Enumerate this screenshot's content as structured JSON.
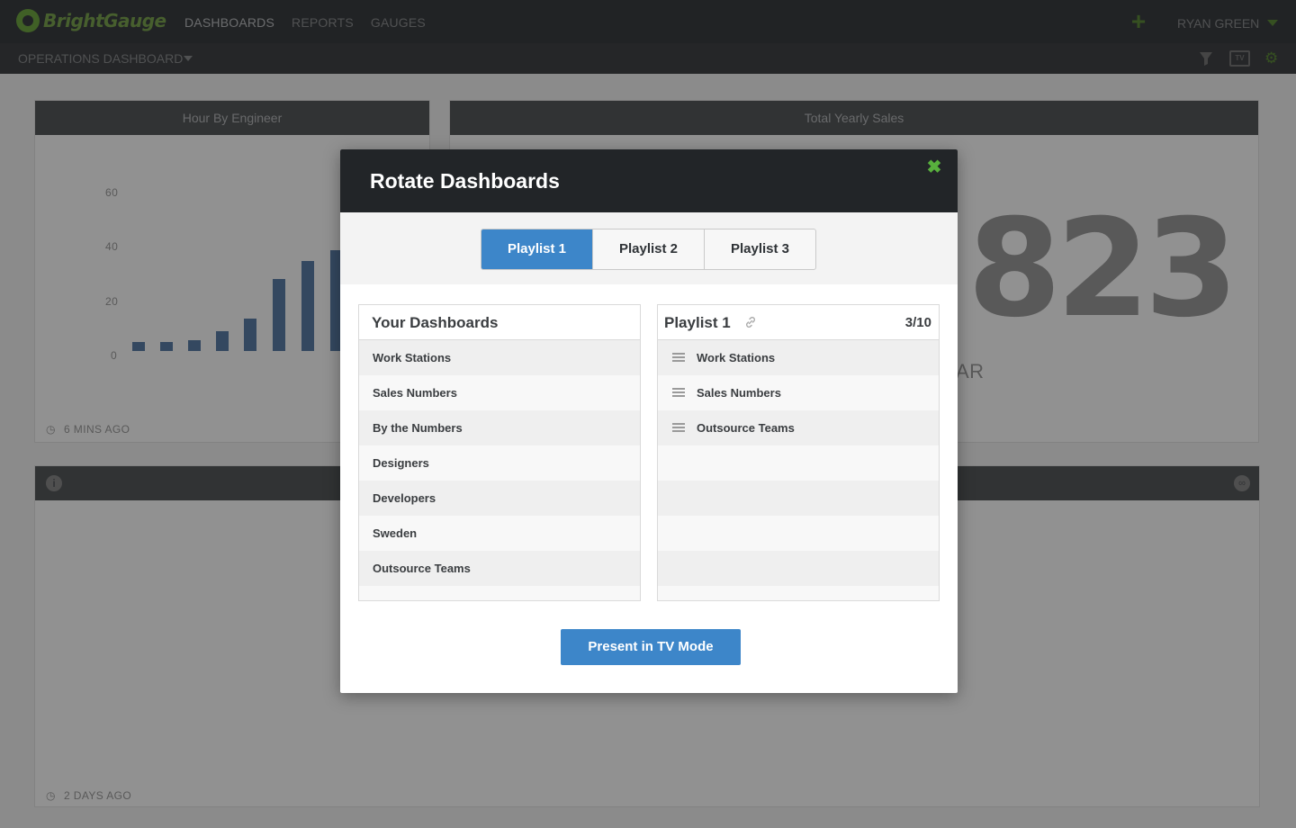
{
  "app": {
    "logo_text": "BrightGauge",
    "nav": [
      "DASHBOARDS",
      "REPORTS",
      "GAUGES"
    ],
    "user_name": "RYAN GREEN",
    "dashboard_title": "OPERATIONS DASHBOARD",
    "accent_color": "#5d8a3a"
  },
  "widgets": {
    "hour_by_engineer": {
      "title": "Hour By Engineer",
      "y_ticks": [
        "60",
        "40",
        "20",
        "0"
      ],
      "updated": "6 MINS AGO"
    },
    "total_yearly_sales": {
      "title": "Total Yearly Sales",
      "value_visible": "823",
      "caption_visible": "AR"
    },
    "bottom": {
      "updated": "2 DAYS AGO"
    }
  },
  "modal": {
    "title": "Rotate Dashboards",
    "close_icon": "close-icon",
    "tabs": [
      {
        "label": "Playlist 1",
        "active": true
      },
      {
        "label": "Playlist 2",
        "active": false
      },
      {
        "label": "Playlist 3",
        "active": false
      }
    ],
    "your_dashboards": {
      "title": "Your Dashboards",
      "items": [
        "Work Stations",
        "Sales Numbers",
        "By the Numbers",
        "Designers",
        "Developers",
        "Sweden",
        "Outsource Teams"
      ]
    },
    "playlist": {
      "title": "Playlist 1",
      "count": "3/10",
      "items": [
        "Work Stations",
        "Sales Numbers",
        "Outsource Teams"
      ]
    },
    "present_button": "Present in TV Mode",
    "primary_color": "#3d86c9"
  }
}
